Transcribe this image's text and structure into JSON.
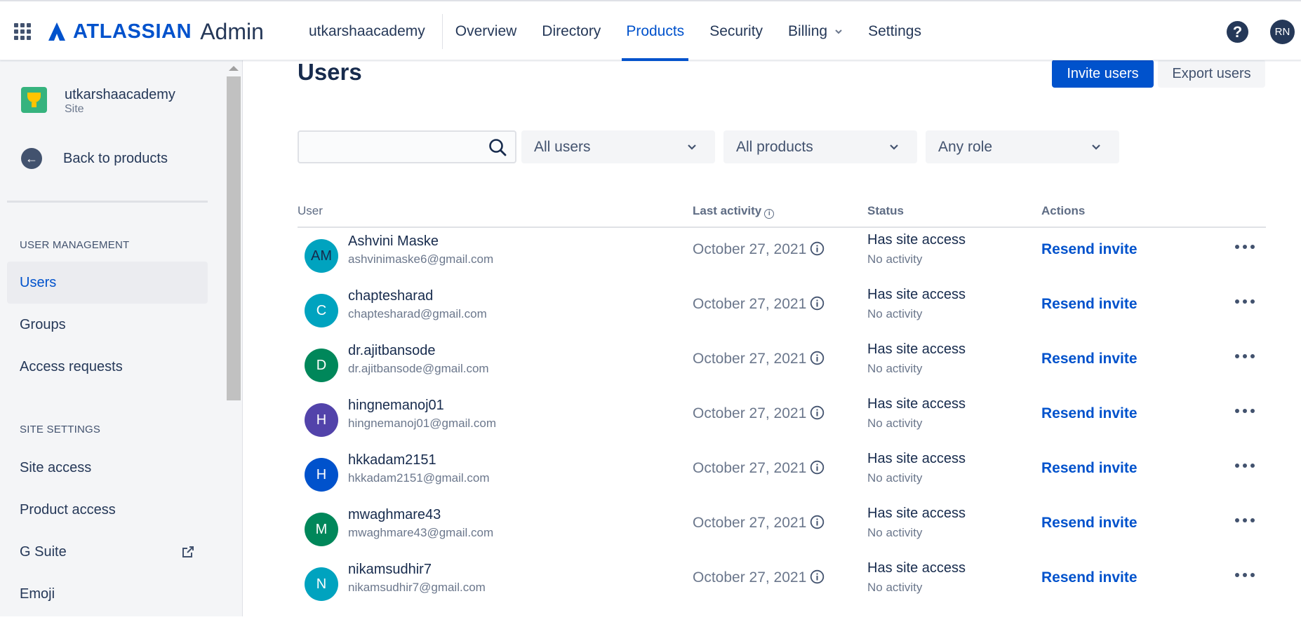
{
  "header": {
    "brand": "ATLASSIAN",
    "product": "Admin",
    "site": "utkarshaacademy",
    "nav": [
      {
        "label": "Overview"
      },
      {
        "label": "Directory"
      },
      {
        "label": "Products",
        "active": true
      },
      {
        "label": "Security"
      },
      {
        "label": "Billing",
        "has_dropdown": true
      },
      {
        "label": "Settings"
      }
    ],
    "help_glyph": "?",
    "user_initials": "RN",
    "brand_color": "#0052cc"
  },
  "sidebar": {
    "site_name": "utkarshaacademy",
    "site_type": "Site",
    "back_label": "Back to products",
    "user_management_heading": "USER MANAGEMENT",
    "user_management_items": [
      {
        "label": "Users",
        "active": true
      },
      {
        "label": "Groups"
      },
      {
        "label": "Access requests"
      }
    ],
    "site_settings_heading": "SITE SETTINGS",
    "site_settings_items": [
      {
        "label": "Site access"
      },
      {
        "label": "Product access"
      },
      {
        "label": "G Suite",
        "icon": "external-link-icon"
      },
      {
        "label": "Emoji"
      }
    ]
  },
  "main": {
    "title": "Users",
    "invite_label": "Invite users",
    "export_label": "Export users",
    "search_placeholder": "",
    "filters": {
      "users": "All users",
      "products": "All products",
      "role": "Any role"
    },
    "columns": {
      "user": "User",
      "last_activity": "Last activity",
      "status": "Status",
      "actions": "Actions"
    },
    "users": [
      {
        "initials": "AM",
        "name": "Ashvini Maske",
        "email": "ashvinimaske6@gmail.com",
        "last_activity": "October 27, 2021",
        "status": "Has site access",
        "substatus": "No activity",
        "action": "Resend invite",
        "avatar_color": "#00a3bf"
      },
      {
        "initials": "C",
        "name": "chaptesharad",
        "email": "chaptesharad@gmail.com",
        "last_activity": "October 27, 2021",
        "status": "Has site access",
        "substatus": "No activity",
        "action": "Resend invite",
        "avatar_color": "#00a3bf"
      },
      {
        "initials": "D",
        "name": "dr.ajitbansode",
        "email": "dr.ajitbansode@gmail.com",
        "last_activity": "October 27, 2021",
        "status": "Has site access",
        "substatus": "No activity",
        "action": "Resend invite",
        "avatar_color": "#00875a"
      },
      {
        "initials": "H",
        "name": "hingnemanoj01",
        "email": "hingnemanoj01@gmail.com",
        "last_activity": "October 27, 2021",
        "status": "Has site access",
        "substatus": "No activity",
        "action": "Resend invite",
        "avatar_color": "#5243aa"
      },
      {
        "initials": "H",
        "name": "hkkadam2151",
        "email": "hkkadam2151@gmail.com",
        "last_activity": "October 27, 2021",
        "status": "Has site access",
        "substatus": "No activity",
        "action": "Resend invite",
        "avatar_color": "#0052cc"
      },
      {
        "initials": "M",
        "name": "mwaghmare43",
        "email": "mwaghmare43@gmail.com",
        "last_activity": "October 27, 2021",
        "status": "Has site access",
        "substatus": "No activity",
        "action": "Resend invite",
        "avatar_color": "#00875a"
      },
      {
        "initials": "N",
        "name": "nikamsudhir7",
        "email": "nikamsudhir7@gmail.com",
        "last_activity": "October 27, 2021",
        "status": "Has site access",
        "substatus": "No activity",
        "action": "Resend invite",
        "avatar_color": "#00a3bf"
      }
    ]
  }
}
